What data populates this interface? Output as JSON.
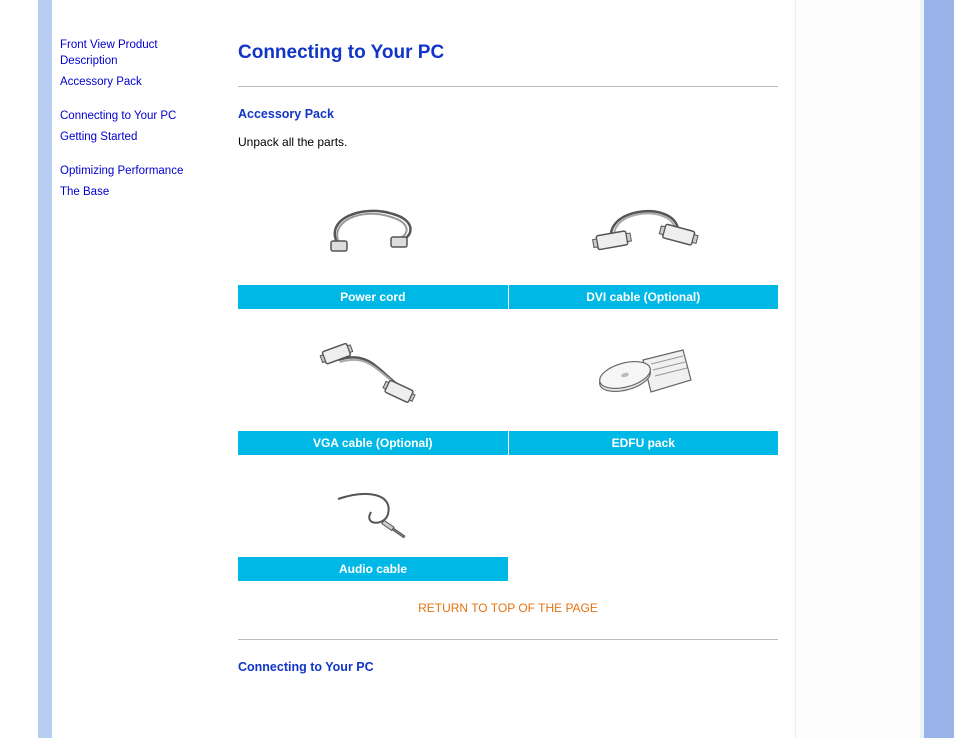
{
  "sidebar": {
    "links": [
      {
        "label": "Front View Product Description"
      },
      {
        "label": "Accessory Pack"
      },
      {
        "label": "Connecting to Your PC"
      },
      {
        "label": "Getting Started"
      },
      {
        "label": "Optimizing Performance"
      },
      {
        "label": "The Base"
      }
    ]
  },
  "page": {
    "title": "Connecting to Your PC",
    "section_accessory": "Accessory Pack",
    "unpack_text": "Unpack all the parts.",
    "return_link": "RETURN TO TOP OF THE PAGE",
    "section_connecting": "Connecting to Your PC"
  },
  "accessories": {
    "row1": {
      "left_label": "Power cord",
      "right_label": "DVI cable (Optional)"
    },
    "row2": {
      "left_label": "VGA cable (Optional)",
      "right_label": "EDFU pack"
    },
    "row3": {
      "left_label": "Audio cable"
    }
  }
}
